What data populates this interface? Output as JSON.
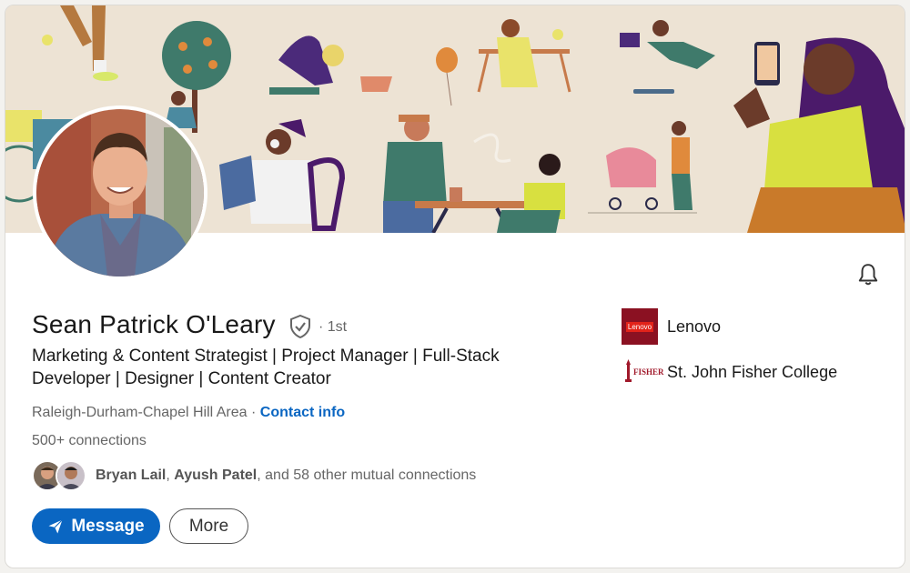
{
  "profile": {
    "name": "Sean Patrick O'Leary",
    "degree": "· 1st",
    "headline": "Marketing & Content Strategist | Project Manager | Full-Stack Developer | Designer | Content Creator",
    "location": "Raleigh-Durham-Chapel Hill Area",
    "location_separator": " · ",
    "contact_info_label": "Contact info",
    "connections": "500+ connections"
  },
  "mutual": {
    "name1": "Bryan Lail",
    "separator": ", ",
    "name2": "Ayush Patel",
    "rest": ", and 58 other mutual connections"
  },
  "actions": {
    "message_label": "Message",
    "more_label": "More"
  },
  "organizations": [
    {
      "name": "Lenovo",
      "logo_text": "Lenovo",
      "icon": "lenovo-logo"
    },
    {
      "name": "St. John Fisher College",
      "logo_text": "FISHER",
      "icon": "fisher-logo"
    }
  ],
  "colors": {
    "accent": "#0a66c2",
    "banner": "#ede3d4",
    "lenovo": "#8b1122",
    "fisher": "#a0182a"
  }
}
